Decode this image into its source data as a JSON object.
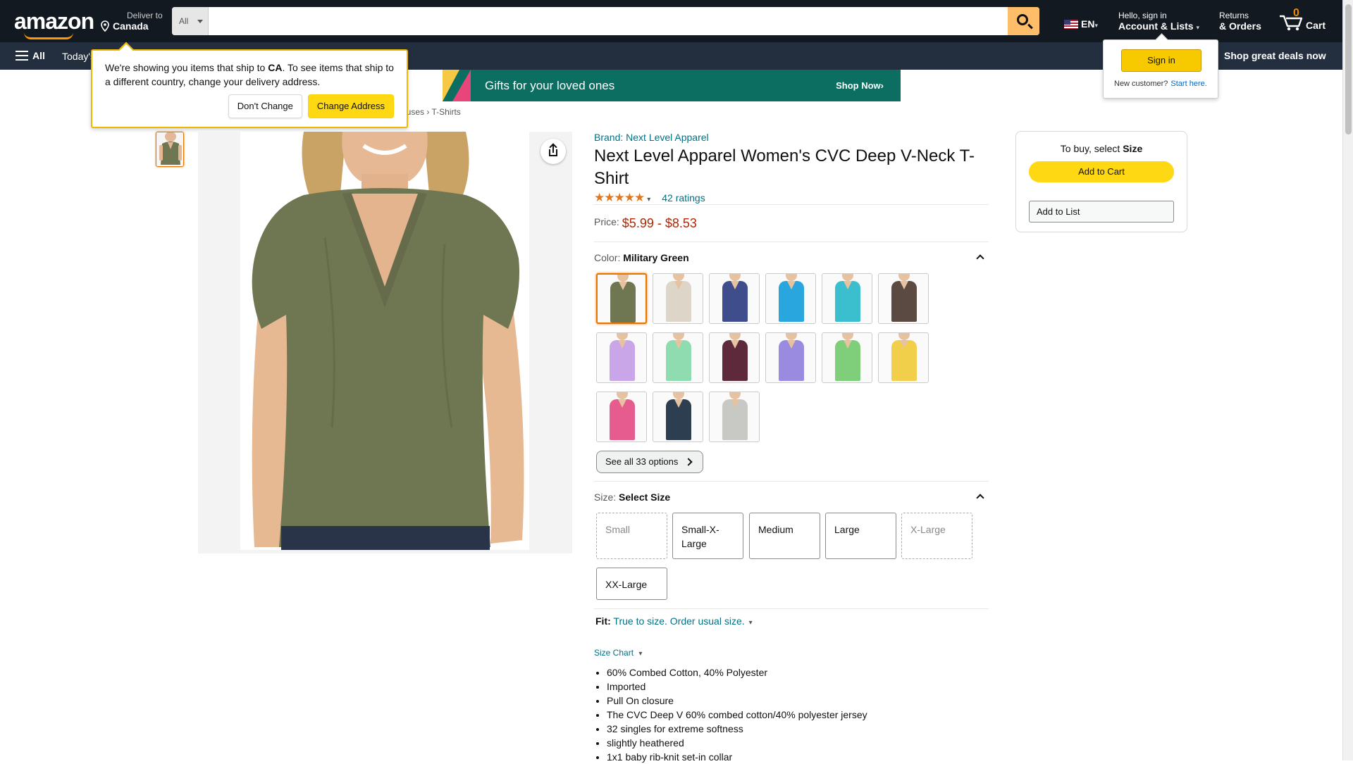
{
  "header": {
    "logo_text": "amazon",
    "deliver_line1": "Deliver to",
    "deliver_line2": "Canada",
    "search_category": "All",
    "search_placeholder": "",
    "language": "EN",
    "account_line1": "Hello, sign in",
    "account_line2": "Account & Lists",
    "returns_line1": "Returns",
    "returns_line2": "& Orders",
    "cart_count": "0",
    "cart_label": "Cart"
  },
  "subnav": {
    "all_label": "All",
    "today_label": "Today's",
    "deals_label": "Shop great deals now"
  },
  "banner": {
    "text": "Gifts for your loved ones",
    "cta": "Shop Now›"
  },
  "breadcrumb": "ouses › T-Shirts",
  "delivery_popover": {
    "text_before": "We're showing you items that ship to ",
    "country": "CA",
    "text_after": ". To see items that ship to a different country, change your delivery address.",
    "dont_change": "Don't Change",
    "change_address": "Change Address"
  },
  "signin_flyout": {
    "button": "Sign in",
    "new_customer": "New customer?",
    "start_here": "Start here."
  },
  "product": {
    "brand": "Brand: Next Level Apparel",
    "title": "Next Level Apparel Women's CVC Deep V-Neck T-Shirt",
    "stars": "★★★★★",
    "ratings": "42 ratings",
    "price_label": "Price:",
    "price": "$5.99 - $8.53",
    "color_label": "Color:",
    "color_value": "Military Green",
    "swatch_colors": [
      "#6f7652",
      "#ddd6c8",
      "#3f4d8c",
      "#2aa6de",
      "#3bbfcf",
      "#5b4a41",
      "#c8a6e8",
      "#8fdcb0",
      "#5e2a3b",
      "#9a8be0",
      "#7fcf7a",
      "#f2cf4a",
      "#e65c8f",
      "#2c3e4f",
      "#c8c8c4"
    ],
    "see_all": "See all 33 options",
    "size_label": "Size:",
    "size_value": "Select Size",
    "sizes": [
      "Small",
      "Small-X-Large",
      "Medium",
      "Large",
      "X-Large",
      "XX-Large"
    ],
    "fit_label": "Fit:",
    "fit_value": "True to size. Order usual size.",
    "size_chart": "Size Chart",
    "bullets": [
      "60% Combed Cotton, 40% Polyester",
      "Imported",
      "Pull On closure",
      "The CVC Deep V 60% combed cotton/40% polyester jersey",
      "32 singles for extreme softness",
      "slightly heathered",
      "1x1 baby rib-knit set-in collar"
    ]
  },
  "buybox": {
    "to_buy": "To buy, select ",
    "to_buy_bold": "Size",
    "add_to_cart": "Add to Cart",
    "add_to_list": "Add to List"
  },
  "colors": {
    "nav_bg": "#131921",
    "subnav_bg": "#232f3e",
    "accent": "#febd69",
    "link": "#007185",
    "price": "#b12704",
    "shirt": "#6f7652"
  }
}
